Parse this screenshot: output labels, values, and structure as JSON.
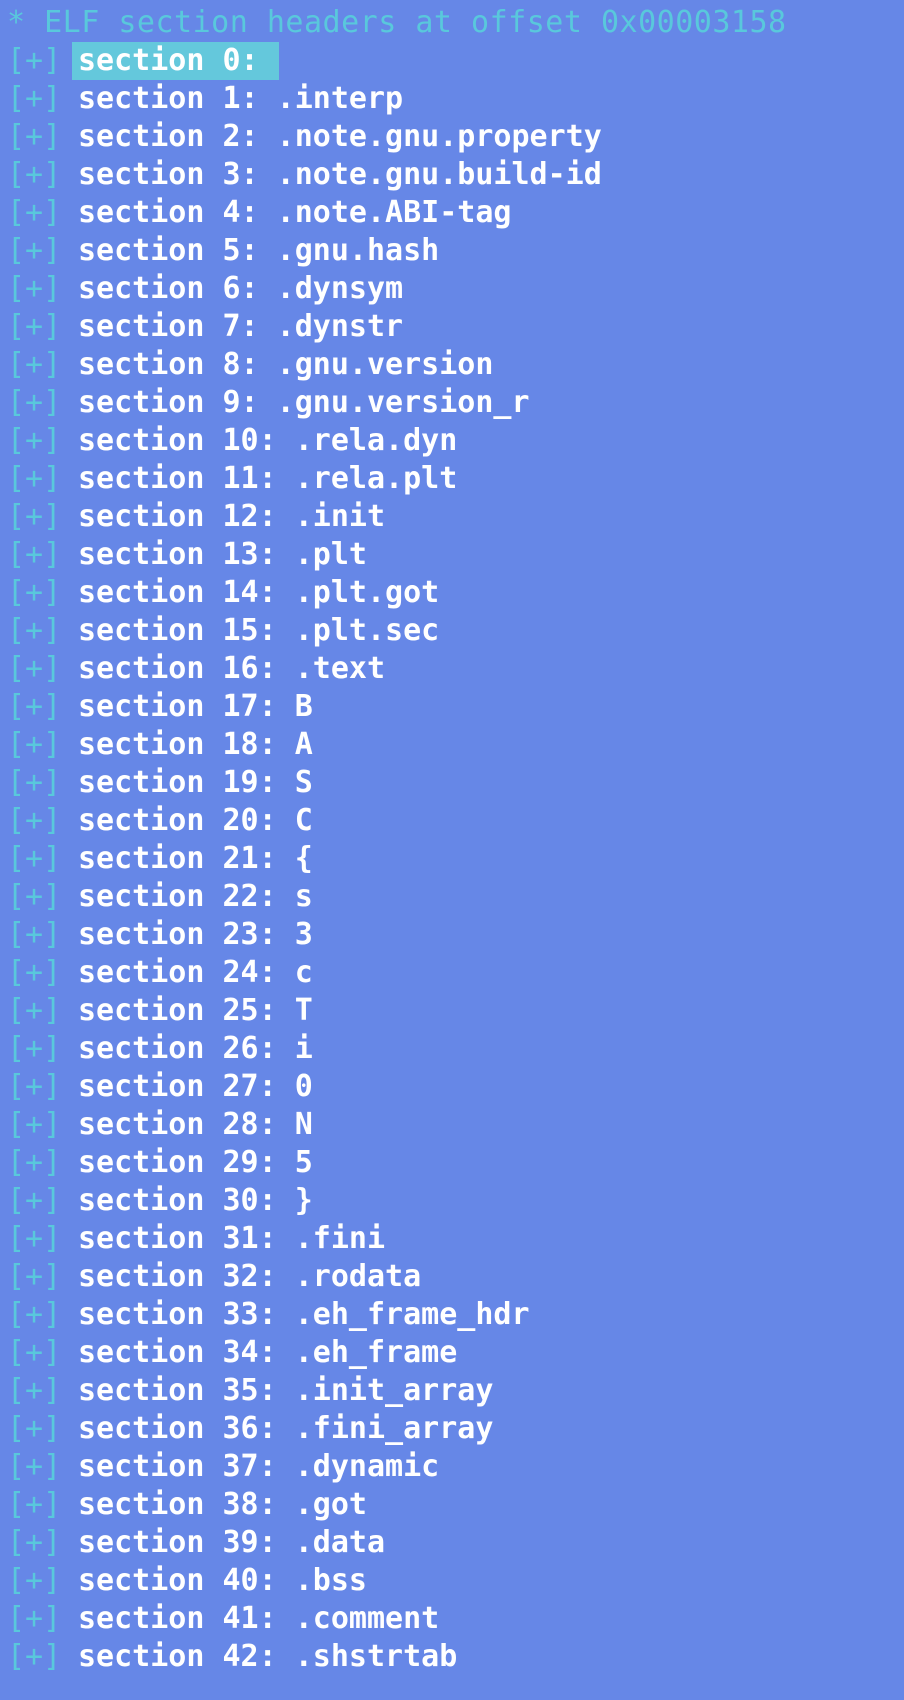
{
  "header": "* ELF section headers at offset 0x00003158",
  "expander_glyph": "[+]",
  "selected_index": 0,
  "colors": {
    "background": "#6687e7",
    "accent": "#59c8dc",
    "text": "#ffffff",
    "selection": "#64c8dc"
  },
  "sections": [
    "section 0:",
    "section 1: .interp",
    "section 2: .note.gnu.property",
    "section 3: .note.gnu.build-id",
    "section 4: .note.ABI-tag",
    "section 5: .gnu.hash",
    "section 6: .dynsym",
    "section 7: .dynstr",
    "section 8: .gnu.version",
    "section 9: .gnu.version_r",
    "section 10: .rela.dyn",
    "section 11: .rela.plt",
    "section 12: .init",
    "section 13: .plt",
    "section 14: .plt.got",
    "section 15: .plt.sec",
    "section 16: .text",
    "section 17: B",
    "section 18: A",
    "section 19: S",
    "section 20: C",
    "section 21: {",
    "section 22: s",
    "section 23: 3",
    "section 24: c",
    "section 25: T",
    "section 26: i",
    "section 27: 0",
    "section 28: N",
    "section 29: 5",
    "section 30: }",
    "section 31: .fini",
    "section 32: .rodata",
    "section 33: .eh_frame_hdr",
    "section 34: .eh_frame",
    "section 35: .init_array",
    "section 36: .fini_array",
    "section 37: .dynamic",
    "section 38: .got",
    "section 39: .data",
    "section 40: .bss",
    "section 41: .comment",
    "section 42: .shstrtab"
  ]
}
